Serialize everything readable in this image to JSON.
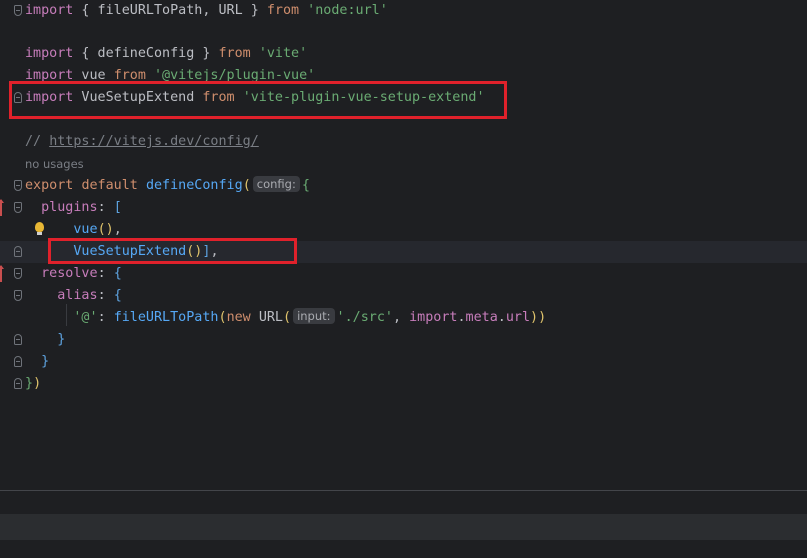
{
  "code": {
    "line1": {
      "k1": "import",
      "p1": " { fileURLToPath, URL } ",
      "k2": "from",
      "p2": " ",
      "s1": "'node:url'"
    },
    "line3": {
      "k1": "import",
      "p1": " { defineConfig } ",
      "k2": "from",
      "p2": " ",
      "s1": "'vite'"
    },
    "line4": {
      "k1": "import",
      "p1": " vue ",
      "k2": "from",
      "p2": " ",
      "s1": "'@vitejs/plugin-vue'"
    },
    "line5": {
      "k1": "import",
      "p1": " VueSetupExtend ",
      "k2": "from",
      "p2": " ",
      "s1": "'vite-plugin-vue-setup-extend'"
    },
    "line7": {
      "c1": "// ",
      "link": "https://vitejs.dev/config/"
    },
    "usage_hint": "no usages",
    "line8": {
      "k1": "export",
      "p1": " ",
      "k2": "default",
      "p2": " ",
      "fn": "defineConfig",
      "open": "(",
      "hint": "config:",
      "brace": "{"
    },
    "line9": {
      "prop": "plugins",
      "p1": ": ",
      "bracket": "["
    },
    "line10": {
      "fn": "vue",
      "paren": "()",
      "p1": ","
    },
    "line11": {
      "fn": "VueSetupExtend",
      "paren": "()",
      "bracket": "]",
      "p1": ","
    },
    "line12": {
      "prop": "resolve",
      "p1": ": ",
      "brace": "{"
    },
    "line13": {
      "prop": "alias",
      "p1": ": ",
      "brace": "{"
    },
    "line14": {
      "s1": "'@'",
      "p1": ": ",
      "fn": "fileURLToPath",
      "open": "(",
      "kw": "new",
      "p2": " ",
      "cls": "URL",
      "open2": "(",
      "hint": "input:",
      "s2": "'./src'",
      "p3": ", ",
      "kw2": "import",
      "dot1": ".",
      "meta": "meta",
      "dot2": ".",
      "url": "url",
      "close": "))"
    },
    "line15": {
      "brace": "}"
    },
    "line16": {
      "brace": "}"
    },
    "line17": {
      "brace": "}",
      "paren": ")"
    }
  },
  "colors": {
    "background": "#1e1f22",
    "keyword": "#cf8e6d",
    "import_keyword": "#c77dbb",
    "function": "#56a8f5",
    "string": "#6aab73",
    "comment": "#7a7e85",
    "highlight_box": "#e0212b"
  },
  "icons": {
    "bulb": "lightbulb-icon",
    "fold": "fold-marker-icon",
    "change": "change-marker-icon"
  }
}
